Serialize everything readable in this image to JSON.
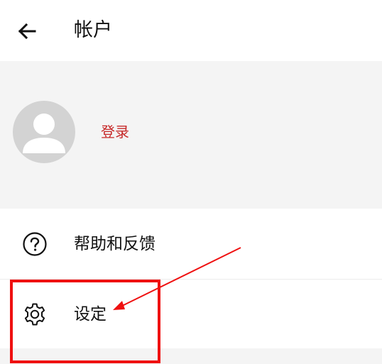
{
  "app_bar": {
    "title": "帐户",
    "back_icon": "arrow-left-icon"
  },
  "profile": {
    "avatar_icon": "person-placeholder-icon",
    "login_label": "登录",
    "accent_color": "#c62828"
  },
  "menu": {
    "items": [
      {
        "label": "帮助和反馈",
        "icon": "help-circle-icon"
      },
      {
        "label": "设定",
        "icon": "gear-icon"
      }
    ]
  },
  "annotation": {
    "highlight_color": "#ef1010",
    "target": "设定"
  }
}
